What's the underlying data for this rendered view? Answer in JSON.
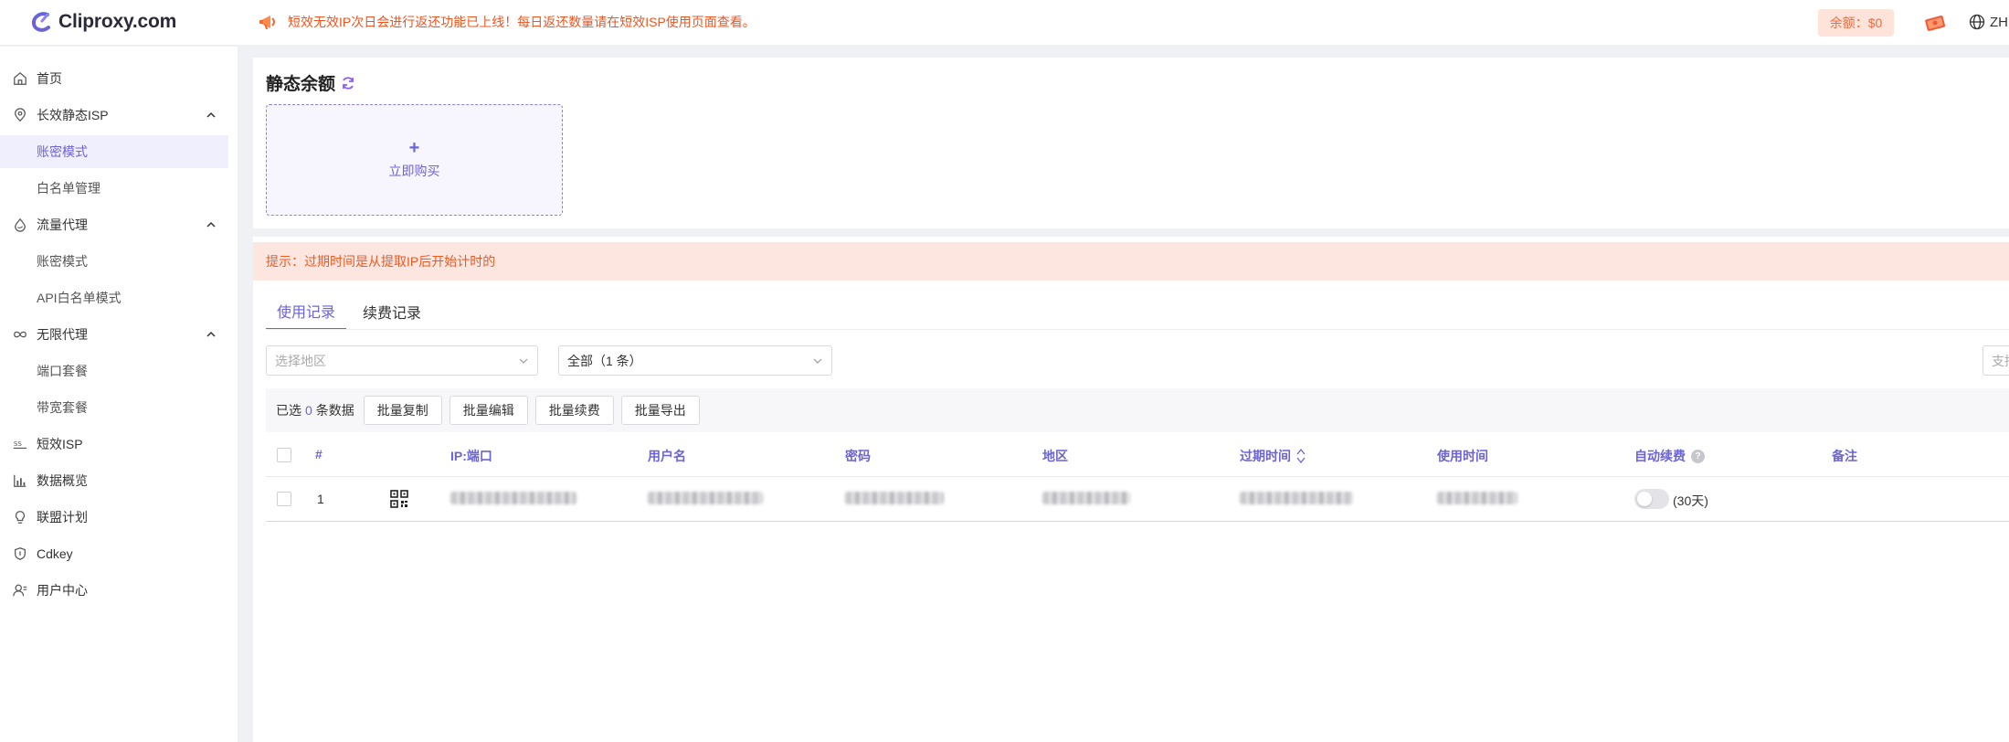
{
  "header": {
    "logo_text": "Cliproxy.com",
    "notice": "短效无效IP次日会进行返还功能已上线！每日返还数量请在短效ISP使用页面查看。",
    "balance": "余额：$0",
    "language": "ZH"
  },
  "sidebar": {
    "items": [
      {
        "label": "首页",
        "icon": "home-icon"
      },
      {
        "label": "长效静态ISP",
        "icon": "location-pin-icon"
      },
      {
        "label": "账密模式",
        "active": true
      },
      {
        "label": "白名单管理"
      },
      {
        "label": "流量代理",
        "icon": "drop-icon"
      },
      {
        "label": "账密模式"
      },
      {
        "label": "API白名单模式"
      },
      {
        "label": "无限代理",
        "icon": "infinity-icon"
      },
      {
        "label": "端口套餐"
      },
      {
        "label": "带宽套餐"
      },
      {
        "label": "短效ISP",
        "icon": "ss-icon"
      },
      {
        "label": "数据概览",
        "icon": "bar-chart-icon"
      },
      {
        "label": "联盟计划",
        "icon": "bulb-icon"
      },
      {
        "label": "Cdkey",
        "icon": "shield-icon"
      },
      {
        "label": "用户中心",
        "icon": "user-icon"
      }
    ]
  },
  "static_balance": {
    "title": "静态余额",
    "buy_plus": "+",
    "buy_label": "立即购买"
  },
  "tip": "提示：过期时间是从提取IP后开始计时的",
  "tabs": [
    "使用记录",
    "续费记录"
  ],
  "filters": {
    "region_placeholder": "选择地区",
    "status_value": "全部（1 条）",
    "search_placeholder": "支持"
  },
  "batch": {
    "selected_prefix": "已选",
    "selected_count": "0",
    "selected_suffix": "条数据",
    "buttons": [
      "批量复制",
      "批量编辑",
      "批量续费",
      "批量导出"
    ]
  },
  "table": {
    "headers": [
      "#",
      "IP:端口",
      "用户名",
      "密码",
      "地区",
      "过期时间",
      "使用时间",
      "自动续费",
      "备注"
    ],
    "rows": [
      {
        "index": "1",
        "auto_renew_days": "(30天)"
      }
    ]
  },
  "colors": {
    "accent": "#6b63d9",
    "warning": "#ee5a24",
    "tip_bg": "#fde6df"
  }
}
